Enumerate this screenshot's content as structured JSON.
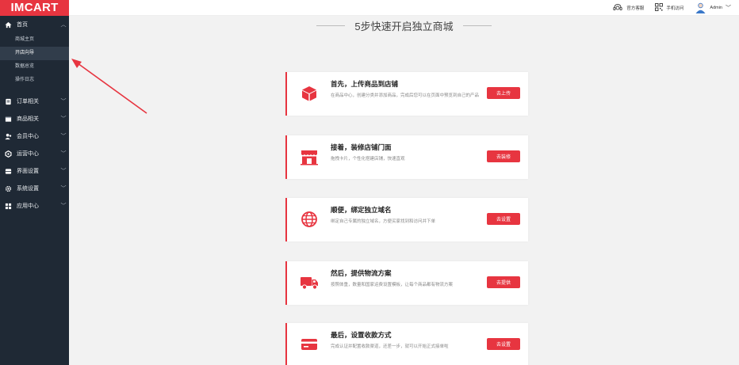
{
  "app": {
    "logo": "IMCART"
  },
  "sidebar": {
    "home": {
      "label": "首页",
      "icon": "home-icon",
      "items": [
        {
          "label": "商城主页"
        },
        {
          "label": "开店向导"
        },
        {
          "label": "数据总览"
        },
        {
          "label": "操作日志"
        }
      ]
    },
    "groups": [
      {
        "label": "订单相关",
        "icon": "order-icon"
      },
      {
        "label": "商品相关",
        "icon": "goods-icon"
      },
      {
        "label": "会员中心",
        "icon": "member-icon"
      },
      {
        "label": "运营中心",
        "icon": "operation-icon"
      },
      {
        "label": "界面设置",
        "icon": "layout-icon"
      },
      {
        "label": "系统设置",
        "icon": "settings-icon"
      },
      {
        "label": "应用中心",
        "icon": "apps-icon"
      }
    ]
  },
  "header": {
    "service_label": "官方客服",
    "qr_label": "手机访问",
    "user_label": "Admin"
  },
  "main": {
    "title": "5步快速开启独立商城",
    "steps": [
      {
        "title": "首先，上传商品到店铺",
        "desc": "在商品中心，创建分类并添加商品，完成后您可以在页面中预览到自己的产品",
        "button": "去上传",
        "icon": "box-icon"
      },
      {
        "title": "接着，装修店铺门面",
        "desc": "拖拽卡片，个性化搭建店铺，快速直观",
        "button": "去装修",
        "icon": "store-icon"
      },
      {
        "title": "顺便，绑定独立域名",
        "desc": "绑定自己专属的独立域名，方便买家找到和访问并下单",
        "button": "去设置",
        "icon": "globe-icon"
      },
      {
        "title": "然后，提供物流方案",
        "desc": "按照体重，数量和国家运费设置模板，让每个商品都有物流方案",
        "button": "去提供",
        "icon": "truck-icon"
      },
      {
        "title": "最后，设置收款方式",
        "desc": "完成认证并配置收款渠道，还差一步，就可以开始正式接单啦",
        "button": "去设置",
        "icon": "card-icon"
      }
    ]
  },
  "colors": {
    "accent": "#e73540",
    "sidebar_bg": "#1f2935",
    "sidebar_active": "#313d4b",
    "page_bg": "#f2f2f2"
  }
}
